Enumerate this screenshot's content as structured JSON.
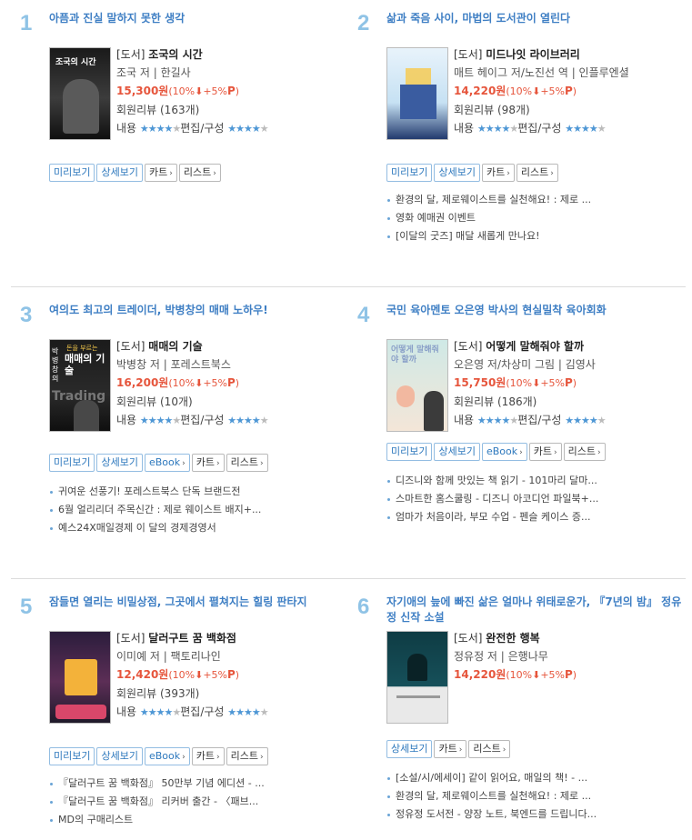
{
  "items": [
    {
      "rank": "1",
      "headline": "아픔과 진실 말하지 못한 생각",
      "type": "[도서]",
      "title": "조국의 시간",
      "author": "조국 저 | 한길사",
      "price": "15,300원",
      "discount": "(10%",
      "point": "+5%",
      "p_mark": "P",
      "close": ")",
      "review_label": "회원리뷰",
      "review_count": "(163개)",
      "content_label": "내용",
      "edit_label": "편집/구성",
      "content_stars": 4,
      "edit_stars": 4,
      "buttons": [
        "미리보기",
        "상세보기",
        "카트",
        "리스트"
      ],
      "bullets": []
    },
    {
      "rank": "2",
      "headline": "삶과 죽음 사이, 마법의 도서관이 열린다",
      "type": "[도서]",
      "title": "미드나잇 라이브러리",
      "author": "매트 헤이그 저/노진선 역 | 인플루엔셜",
      "price": "14,220원",
      "discount": "(10%",
      "point": "+5%",
      "p_mark": "P",
      "close": ")",
      "review_label": "회원리뷰",
      "review_count": "(98개)",
      "content_label": "내용",
      "edit_label": "편집/구성",
      "content_stars": 4,
      "edit_stars": 4,
      "buttons": [
        "미리보기",
        "상세보기",
        "카트",
        "리스트"
      ],
      "bullets": [
        "환경의 달, 제로웨이스트를 실천해요! : 제로 ...",
        "영화 예매권 이벤트",
        "[이달의 굿즈] 매달 새롭게 만나요!"
      ]
    },
    {
      "rank": "3",
      "headline": "여의도 최고의 트레이더, 박병창의 매매 노하우!",
      "type": "[도서]",
      "title": "매매의 기술",
      "author": "박병창 저 | 포레스트북스",
      "price": "16,200원",
      "discount": "(10%",
      "point": "+5%",
      "p_mark": "P",
      "close": ")",
      "review_label": "회원리뷰",
      "review_count": "(10개)",
      "content_label": "내용",
      "edit_label": "편집/구성",
      "content_stars": 4,
      "edit_stars": 4,
      "buttons": [
        "미리보기",
        "상세보기",
        "eBook",
        "카트",
        "리스트"
      ],
      "bullets": [
        "귀여운 선풍기! 포레스트북스 단독 브랜드전",
        "6월 얼리리더 주목신간 : 제로 웨이스트 배지+...",
        "예스24X매일경제 이 달의 경제경영서"
      ]
    },
    {
      "rank": "4",
      "headline": "국민 육아멘토 오은영 박사의 현실밀착 육아회화",
      "type": "[도서]",
      "title": "어떻게 말해줘야 할까",
      "author": "오은영 저/차상미 그림 | 김영사",
      "price": "15,750원",
      "discount": "(10%",
      "point": "+5%",
      "p_mark": "P",
      "close": ")",
      "review_label": "회원리뷰",
      "review_count": "(186개)",
      "content_label": "내용",
      "edit_label": "편집/구성",
      "content_stars": 4,
      "edit_stars": 4,
      "buttons": [
        "미리보기",
        "상세보기",
        "eBook",
        "카트",
        "리스트"
      ],
      "bullets": [
        "디즈니와 함께 맛있는 책 읽기 - 101마리 달마...",
        "스마트한 홈스쿨링 - 디즈니 아코디언 파일북+...",
        "엄마가 처음이라, 부모 수업 - 펜슬 케이스 증..."
      ]
    },
    {
      "rank": "5",
      "headline": "잠들면 열리는 비밀상점, 그곳에서 펼쳐지는 힐링 판타지",
      "type": "[도서]",
      "title": "달러구트 꿈 백화점",
      "author": "이미예 저 | 팩토리나인",
      "price": "12,420원",
      "discount": "(10%",
      "point": "+5%",
      "p_mark": "P",
      "close": ")",
      "review_label": "회원리뷰",
      "review_count": "(393개)",
      "content_label": "내용",
      "edit_label": "편집/구성",
      "content_stars": 4,
      "edit_stars": 4,
      "buttons": [
        "미리보기",
        "상세보기",
        "eBook",
        "카트",
        "리스트"
      ],
      "bullets": [
        "『달러구트 꿈 백화점』 50만부 기념 에디션 - ...",
        "『달러구트 꿈 백화점』 리커버 출간 - 〈패브...",
        "MD의 구매리스트"
      ]
    },
    {
      "rank": "6",
      "headline": "자기애의 늪에 빠진 삶은 얼마나 위태로운가, 『7년의 밤』 정유정 신작 소설",
      "type": "[도서]",
      "title": "완전한 행복",
      "author": "정유정 저 | 은행나무",
      "price": "14,220원",
      "discount": "(10%",
      "point": "+5%",
      "p_mark": "P",
      "close": ")",
      "review_label": "",
      "review_count": "",
      "content_label": "",
      "edit_label": "",
      "content_stars": 0,
      "edit_stars": 0,
      "buttons": [
        "상세보기",
        "카트",
        "리스트"
      ],
      "bullets": [
        "[소설/시/에세이] 같이 읽어요, 매일의 책! - ...",
        "환경의 달, 제로웨이스트를 실천해요! : 제로 ...",
        "정유정 도서전 - 양장 노트, 북엔드를 드립니다..."
      ]
    }
  ],
  "cover_text": {
    "c1": "조국의 시간",
    "c3_top": "돈을 부르는",
    "c3_main": "매매의 기술",
    "c3_side": "박병창의",
    "c3_brand": "Trading",
    "c4": "어떻게 말해줘야 할까"
  },
  "colors": {
    "headline": "#3f7fc4",
    "rank": "#8fc3e6",
    "price": "#e6553c",
    "star_on": "#4e97d5",
    "star_off": "#bbbbbb"
  }
}
